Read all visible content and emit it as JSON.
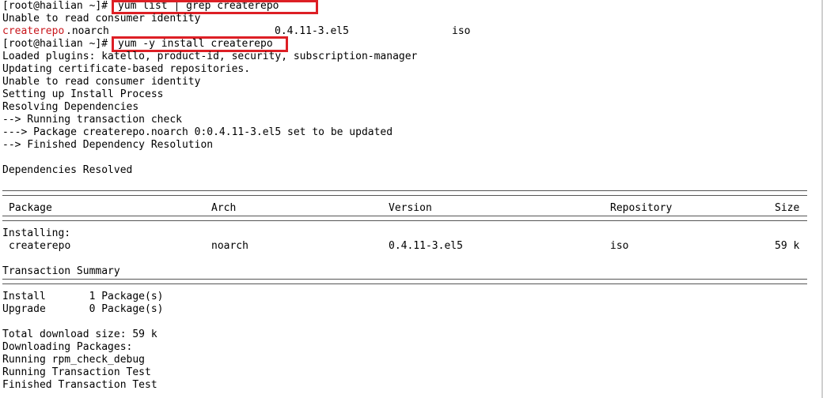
{
  "terminal": {
    "prompt": "[root@hailian ~]#",
    "cmd1": "yum list | grep createrepo",
    "msg_unable1": "Unable to read consumer identity",
    "list_row": {
      "name": "createrepo",
      "arch_suffix": ".noarch",
      "version": "0.4.11-3.el5",
      "repo": "iso"
    },
    "cmd2": "yum -y install createrepo",
    "output1": [
      "Loaded plugins: katello, product-id, security, subscription-manager",
      "Updating certificate-based repositories.",
      "Unable to read consumer identity",
      "Setting up Install Process",
      "Resolving Dependencies",
      "--> Running transaction check",
      "---> Package createrepo.noarch 0:0.4.11-3.el5 set to be updated",
      "--> Finished Dependency Resolution"
    ],
    "deps_resolved": "Dependencies Resolved",
    "table": {
      "headers": {
        "package": "Package",
        "arch": "Arch",
        "version": "Version",
        "repository": "Repository",
        "size": "Size"
      },
      "section": "Installing:",
      "row": {
        "package": "createrepo",
        "arch": "noarch",
        "version": "0.4.11-3.el5",
        "repository": "iso",
        "size": "59 k"
      }
    },
    "transaction_summary": "Transaction Summary",
    "install_line": "Install       1 Package(s)",
    "upgrade_line": "Upgrade       0 Package(s)",
    "output2": [
      "Total download size: 59 k",
      "Downloading Packages:",
      "Running rpm_check_debug",
      "Running Transaction Test",
      "Finished Transaction Test"
    ],
    "colors": {
      "highlight_box": "#dd1f25",
      "package_name": "#c8151b",
      "text": "#000000",
      "background": "#ffffff"
    }
  }
}
